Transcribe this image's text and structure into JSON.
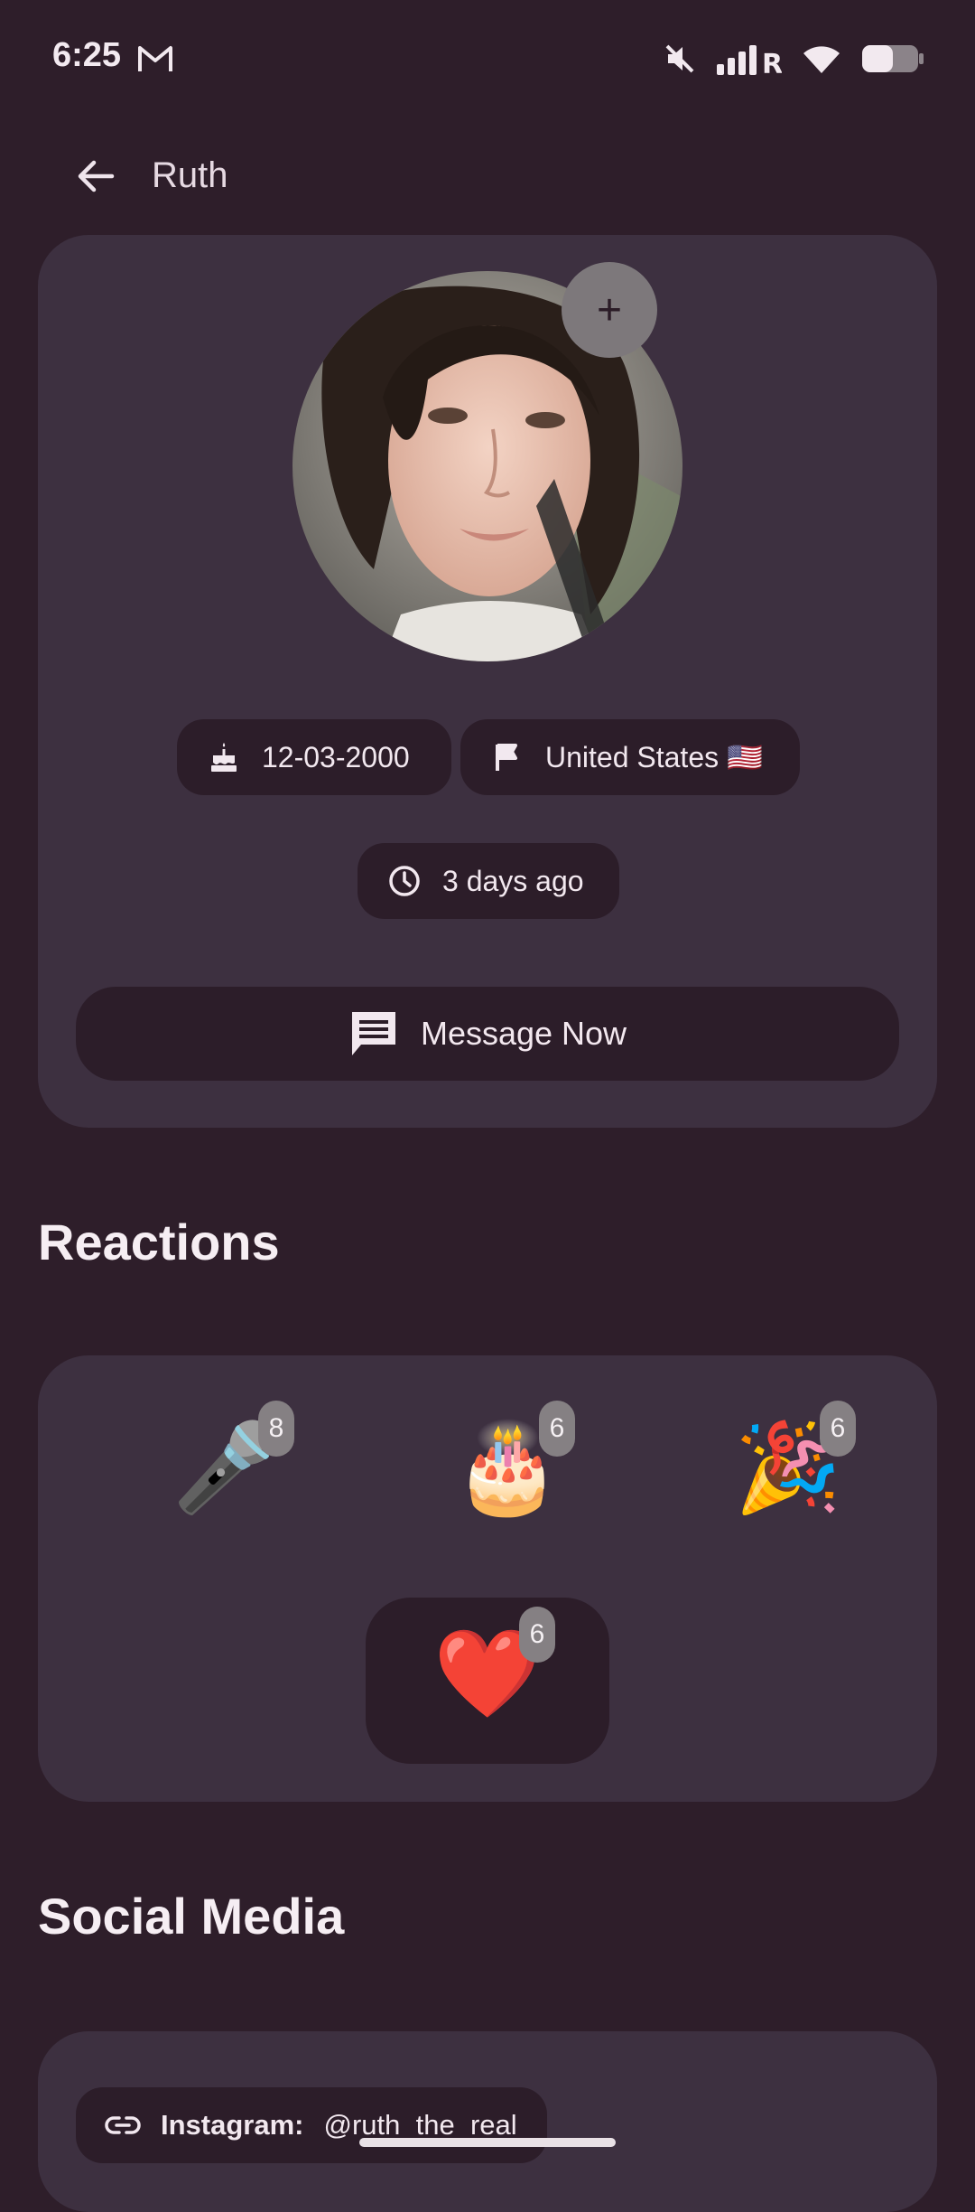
{
  "status": {
    "time": "6:25"
  },
  "header": {
    "title": "Ruth"
  },
  "profile": {
    "add_photo_label": "+",
    "birthday": "12-03-2000",
    "country": "United States 🇺🇸",
    "last_seen": "3 days ago",
    "message_button": "Message Now"
  },
  "reactions": {
    "title": "Reactions",
    "items": [
      {
        "emoji": "🎤",
        "count": "8"
      },
      {
        "emoji": "🎂",
        "count": "6"
      },
      {
        "emoji": "🎉",
        "count": "6"
      },
      {
        "emoji": "❤️",
        "count": "6"
      }
    ]
  },
  "social": {
    "title": "Social Media",
    "items": [
      {
        "label": "Instagram:",
        "handle": "@ruth_the_real"
      }
    ]
  },
  "colors": {
    "background": "#2e1e2a",
    "card": "#3d3040",
    "chip": "#2c1d29",
    "badge": "#858083"
  }
}
